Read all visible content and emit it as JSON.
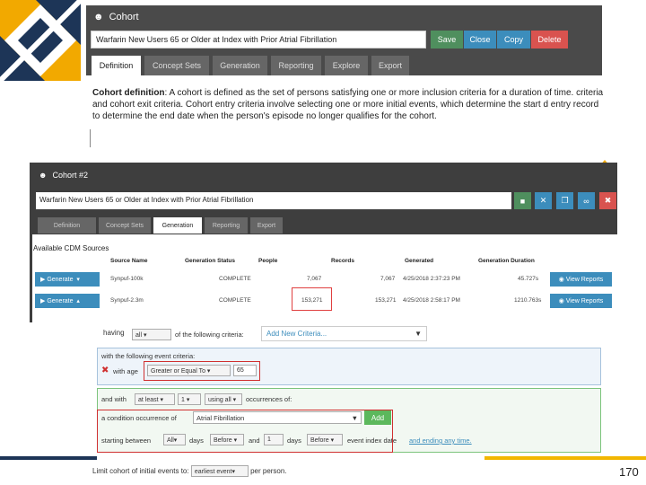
{
  "top": {
    "header_title": "Cohort",
    "cohort_name": "Warfarin New Users 65 or Older at Index with Prior Atrial Fibrillation",
    "buttons": {
      "save": "Save",
      "close": "Close",
      "copy": "Copy",
      "delete": "Delete"
    },
    "tabs": [
      "Definition",
      "Concept Sets",
      "Generation",
      "Reporting",
      "Explore",
      "Export"
    ],
    "definition_bold": "Cohort definition",
    "definition_text": ": A cohort is defined as the set of persons satisfying one or more inclusion criteria for a duration of time. criteria and cohort exit criteria. Cohort entry criteria involve selecting one or more initial events, which determine the start d entry record to determine the end date when the person's episode no longer qualifies for the cohort."
  },
  "panel2": {
    "header_title": "Cohort #2",
    "cohort_name": "Warfarin New Users 65 or Older at Index with Prior Atrial Fibrillation",
    "tabs": [
      "Definition",
      "Concept Sets",
      "Generation",
      "Reporting",
      "Export"
    ],
    "available_label": "Available CDM Sources",
    "columns": [
      "Source Name",
      "Generation Status",
      "People",
      "Records",
      "Generated",
      "Generation Duration"
    ],
    "rows": [
      {
        "generate": "Generate",
        "source": "Synpuf-100k",
        "status": "COMPLETE",
        "people": "7,067",
        "records": "7,067",
        "generated": "4/25/2018 2:37:23 PM",
        "duration": "45.727s",
        "view": "View Reports"
      },
      {
        "generate": "Generate",
        "source": "Synpuf-2.3m",
        "status": "COMPLETE",
        "people": "153,271",
        "records": "153,271",
        "generated": "4/25/2018 2:58:17 PM",
        "duration": "1210.763s",
        "view": "View Reports"
      }
    ]
  },
  "criteria": {
    "having": "having",
    "all_select": "all",
    "of_following": "of the following criteria:",
    "add_new": "Add New Criteria...",
    "with_following_event": "with the following event criteria:",
    "with_age": "with age",
    "age_op": "Greater or Equal To",
    "age_value": "65",
    "and_with": "and with",
    "at_least": "at least",
    "count": "1",
    "using_all": "using all",
    "occurrences_of": "occurrences of:",
    "condition_occurrence": "a condition occurrence of",
    "condition": "Atrial Fibrillation",
    "add": "Add",
    "starting_between": "starting between",
    "all": "All",
    "days": "days",
    "before": "Before",
    "and": "and",
    "one": "1",
    "days2": "days",
    "before2": "Before",
    "event_index_date": "event index date",
    "and_ending_any_time": "and ending any time.",
    "limit_label": "Limit cohort of initial events to:",
    "limit_value": "earliest event",
    "per_person": "per person."
  },
  "page_number": "170",
  "colors": {
    "save": "#4f8f5e",
    "close": "#3c8dbc",
    "copy": "#3c8dbc",
    "delete": "#d9534f",
    "accent": "#f2b600"
  }
}
